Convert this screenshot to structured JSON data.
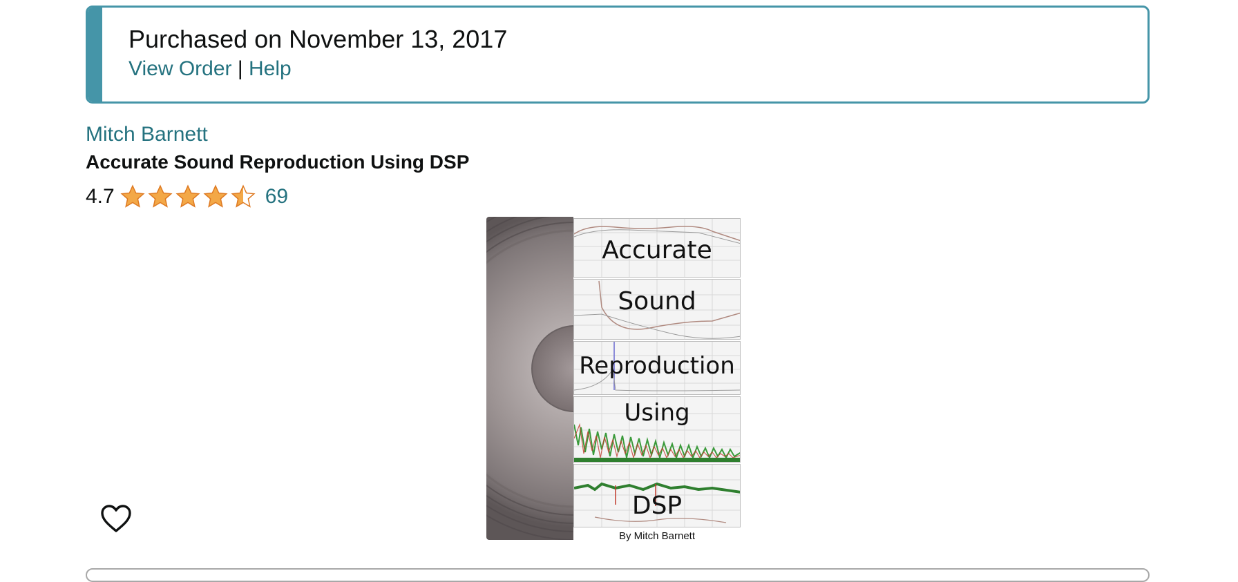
{
  "purchase": {
    "title": "Purchased on November 13, 2017",
    "view_order": "View Order",
    "separator": "|",
    "help": "Help"
  },
  "book": {
    "author": "Mitch Barnett",
    "title": "Accurate Sound Reproduction Using DSP",
    "rating": "4.7",
    "rating_fraction": 0.94,
    "ratings_count": "69",
    "cover": {
      "words": [
        "Accurate",
        "Sound",
        "Reproduction",
        "Using",
        "DSP"
      ],
      "byline": "By Mitch Barnett"
    }
  },
  "icons": {
    "wishlist": "heart-outline-icon",
    "star_full": "star-icon",
    "star_half": "star-half-icon"
  },
  "colors": {
    "accent": "#4595a8",
    "link": "#24727f",
    "star": "#f3a847",
    "star_border": "#de7921"
  }
}
